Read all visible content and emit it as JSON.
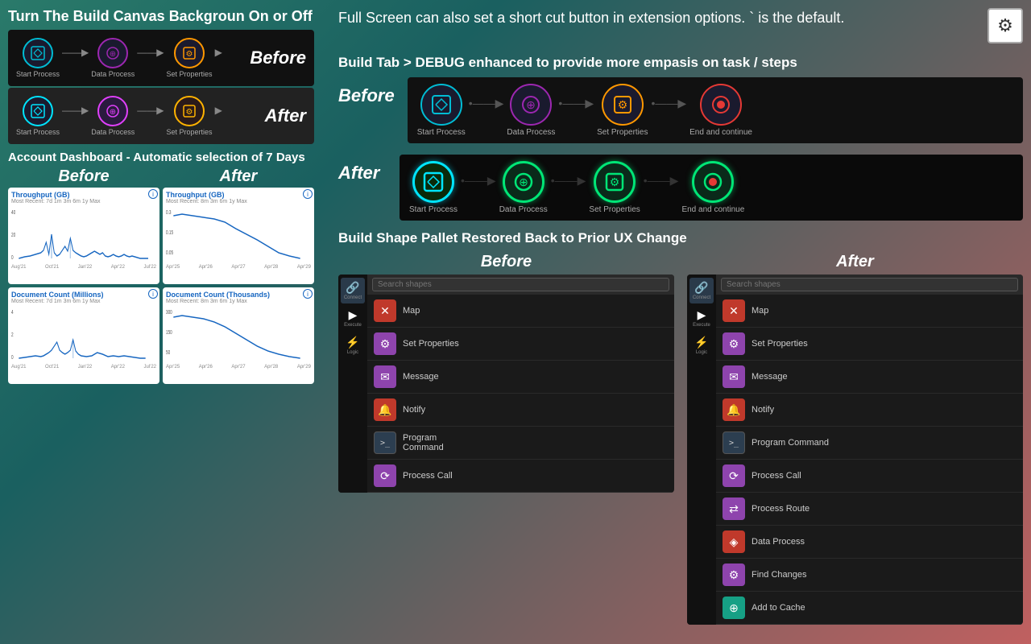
{
  "left": {
    "section1_title": "Turn The Build Canvas Backgroun On or Off",
    "before_label": "Before",
    "after_label": "After",
    "nodes_canvas": [
      {
        "label": "Start Process",
        "type": "blue"
      },
      {
        "label": "Data Process",
        "type": "purple"
      },
      {
        "label": "Set Properties",
        "type": "orange"
      }
    ],
    "dashboard_title": "Account Dashboard - Automatic selection of 7 Days",
    "before_label2": "Before",
    "after_label2": "After",
    "chart1_before": {
      "title": "Throughput (GB)",
      "subtitle": "Most Recent: 7d 1m 3m 6m 1y Max",
      "y_max": "40",
      "y_mid": "20",
      "y_zero": "0"
    },
    "chart1_after": {
      "title": "Throughput (GB)",
      "subtitle": "Most Recent: 8m 3m 6m 1y Max",
      "y_max": "0.3",
      "y_mid": "0.15",
      "y_zero": "0.05"
    },
    "chart2_before": {
      "title": "Document Count (Millions)",
      "subtitle": "Most Recent: 7d 1m 3m 6m 1y Max",
      "y_max": "4",
      "y_mid": "2",
      "y_zero": "0"
    },
    "chart2_after": {
      "title": "Document Count (Thousands)",
      "subtitle": "Most Recent: 8m 3m 6m 1y Max",
      "y_max": "300",
      "y_mid": "150",
      "y_zero": "50"
    }
  },
  "right": {
    "fullscreen_text": "Full Screen can also set a short cut button in extension options. ` is the default.",
    "gear_icon": "⚙",
    "debug_title": "Build Tab > DEBUG enhanced to provide more empasis on task / steps",
    "before_label": "Before",
    "after_label": "After",
    "debug_nodes": [
      {
        "label": "Start Process",
        "type": "blue"
      },
      {
        "label": "Data Process",
        "type": "purple"
      },
      {
        "label": "Set Properties",
        "type": "orange"
      },
      {
        "label": "End and continue",
        "type": "red"
      }
    ],
    "shape_pallet_title": "Build Shape Pallet Restored Back to Prior UX Change",
    "before_label2": "Before",
    "after_label2": "After",
    "search_placeholder": "Search shapes",
    "sidebar_items": [
      {
        "label": "Connect",
        "icon": "🔗"
      },
      {
        "label": "Execute",
        "icon": "▶"
      },
      {
        "label": "Logic",
        "icon": "⚡"
      }
    ],
    "pallet_items_before": [
      {
        "label": "Map",
        "icon": "✕",
        "color": "ic-map"
      },
      {
        "label": "Set Properties",
        "icon": "⚙",
        "color": "ic-setprops"
      },
      {
        "label": "Message",
        "icon": "✉",
        "color": "ic-message"
      },
      {
        "label": "Notify",
        "icon": "🔔",
        "color": "ic-notify"
      },
      {
        "label": "Program Command",
        "icon": ">_",
        "color": "ic-progcmd"
      },
      {
        "label": "Process Call",
        "icon": "⟳",
        "color": "ic-processcall"
      }
    ],
    "pallet_items_after": [
      {
        "label": "Map",
        "icon": "✕",
        "color": "ic-map"
      },
      {
        "label": "Set Properties",
        "icon": "⚙",
        "color": "ic-setprops"
      },
      {
        "label": "Message",
        "icon": "✉",
        "color": "ic-message"
      },
      {
        "label": "Notify",
        "icon": "🔔",
        "color": "ic-notify"
      },
      {
        "label": "Program Command",
        "icon": ">_",
        "color": "ic-progcmd"
      },
      {
        "label": "Process Call",
        "icon": "⟳",
        "color": "ic-processcall"
      },
      {
        "label": "Process Route",
        "icon": "⇄",
        "color": "ic-processroute"
      },
      {
        "label": "Data Process",
        "icon": "◈",
        "color": "ic-dataprocess"
      },
      {
        "label": "Find Changes",
        "icon": "⚙",
        "color": "ic-findchanges"
      },
      {
        "label": "Add to Cache",
        "icon": "⊕",
        "color": "ic-addcache"
      }
    ]
  }
}
